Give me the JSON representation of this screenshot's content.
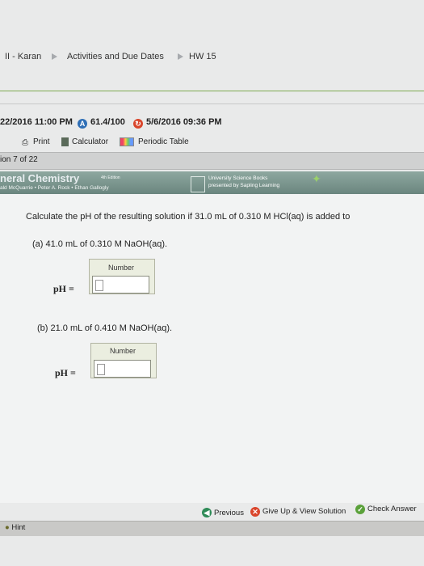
{
  "breadcrumb": {
    "item1": "II - Karan",
    "item2": "Activities and Due Dates",
    "item3": "HW 15"
  },
  "status": {
    "due": "22/2016 11:00 PM",
    "score": "61.4/100",
    "submitted": "5/6/2016 09:36 PM"
  },
  "toolbar": {
    "print": "Print",
    "calculator": "Calculator",
    "periodic_table": "Periodic Table"
  },
  "question_counter": "ion 7 of 22",
  "banner": {
    "title": "neral Chemistry",
    "edition": "4th Edition",
    "authors": "ald McQuarrie • Peter A. Rock • Ethan Gallogly",
    "publisher_line1": "University Science Books",
    "publisher_line2": "presented by Sapling Learning"
  },
  "question": {
    "prompt": "Calculate the pH of the resulting solution if 31.0 mL of 0.310 M HCl(aq) is added to",
    "part_a": "(a) 41.0 mL of 0.310 M NaOH(aq).",
    "part_b": "(b) 21.0 mL of 0.410 M NaOH(aq).",
    "field_label": "Number",
    "ph_label": "pH ="
  },
  "footer": {
    "previous": "Previous",
    "give_up": "Give Up & View Solution",
    "check": "Check Answer",
    "hint": "Hint"
  },
  "colors": {
    "accent_green": "#7faa52",
    "score_blue": "#2f6fb6",
    "alert_red": "#d9452b"
  }
}
